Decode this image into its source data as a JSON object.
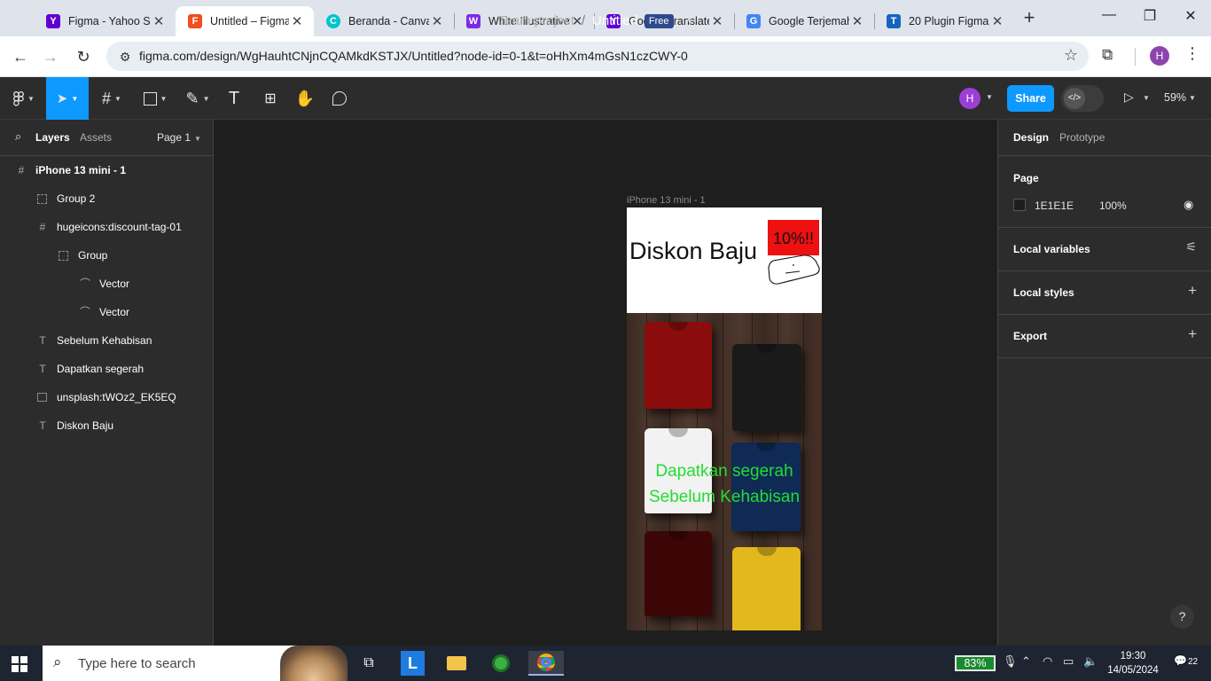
{
  "browser": {
    "tabs": [
      {
        "title": "Figma - Yahoo S",
        "icon": "yahoo-icon",
        "color": "#6001d2",
        "glyph": "Y"
      },
      {
        "title": "Untitled – Figma",
        "icon": "figma-icon",
        "color": "#f24e1e",
        "glyph": "F"
      },
      {
        "title": "Beranda - Canva",
        "icon": "canva-icon",
        "color": "#00c4cc",
        "glyph": "C"
      },
      {
        "title": "White Illustrative",
        "icon": "canva-design-icon",
        "color": "#7d2ae8",
        "glyph": "W"
      },
      {
        "title": "Google Translate",
        "icon": "yahoo-icon",
        "color": "#6001d2",
        "glyph": "Y"
      },
      {
        "title": "Google Terjemah",
        "icon": "google-translate-icon",
        "color": "#4285f4",
        "glyph": "G"
      },
      {
        "title": "20 Plugin Figma",
        "icon": "t-icon",
        "color": "#1565c0",
        "glyph": "T"
      }
    ],
    "url": "figma.com/design/WgHauhtCNjnCQAMkdKSTJX/Untitled?node-id=0-1&t=oHhXm4mGsN1czCWY-0",
    "profile_initial": "H"
  },
  "figma": {
    "breadcrumb": {
      "team": "Team project",
      "separator": "/",
      "file": "Untitled",
      "plan": "Free"
    },
    "user_initial": "H",
    "share_label": "Share",
    "zoom": "59%",
    "left_panel": {
      "tabs": {
        "layers": "Layers",
        "assets": "Assets"
      },
      "page": "Page 1",
      "layers": [
        {
          "name": "iPhone 13 mini - 1",
          "type": "frame",
          "indent": 0
        },
        {
          "name": "Group 2",
          "type": "group",
          "indent": 1
        },
        {
          "name": "hugeicons:discount-tag-01",
          "type": "frame",
          "indent": 1
        },
        {
          "name": "Group",
          "type": "group",
          "indent": 2
        },
        {
          "name": "Vector",
          "type": "vector",
          "indent": 3
        },
        {
          "name": "Vector",
          "type": "vector",
          "indent": 3
        },
        {
          "name": "Sebelum Kehabisan",
          "type": "text",
          "indent": 1
        },
        {
          "name": "Dapatkan segerah",
          "type": "text",
          "indent": 1
        },
        {
          "name": "unsplash:tWOz2_EK5EQ",
          "type": "image",
          "indent": 1
        },
        {
          "name": "Diskon Baju",
          "type": "text",
          "indent": 1
        }
      ]
    },
    "canvas": {
      "frame_label": "iPhone 13 mini - 1",
      "title": "Diskon Baju",
      "tag_text": "10%!!",
      "cta_line1": "Dapatkan segerah",
      "cta_line2": "Sebelum Kehabisan",
      "cta_color": "#22dd33",
      "tag_color": "#ee1111",
      "shirt_colors": [
        "#8b0c0c",
        "#1a1a1a",
        "#f2f2f2",
        "#0f2a55",
        "#3d0606",
        "#e2b81c"
      ]
    },
    "right_panel": {
      "tabs": {
        "design": "Design",
        "prototype": "Prototype"
      },
      "page_section": "Page",
      "page_color_hex": "1E1E1E",
      "page_opacity": "100%",
      "sections": [
        "Local variables",
        "Local styles",
        "Export"
      ]
    }
  },
  "taskbar": {
    "search_placeholder": "Type here to search",
    "battery": "83%",
    "time": "19:30",
    "date": "14/05/2024",
    "notifications": "22"
  }
}
